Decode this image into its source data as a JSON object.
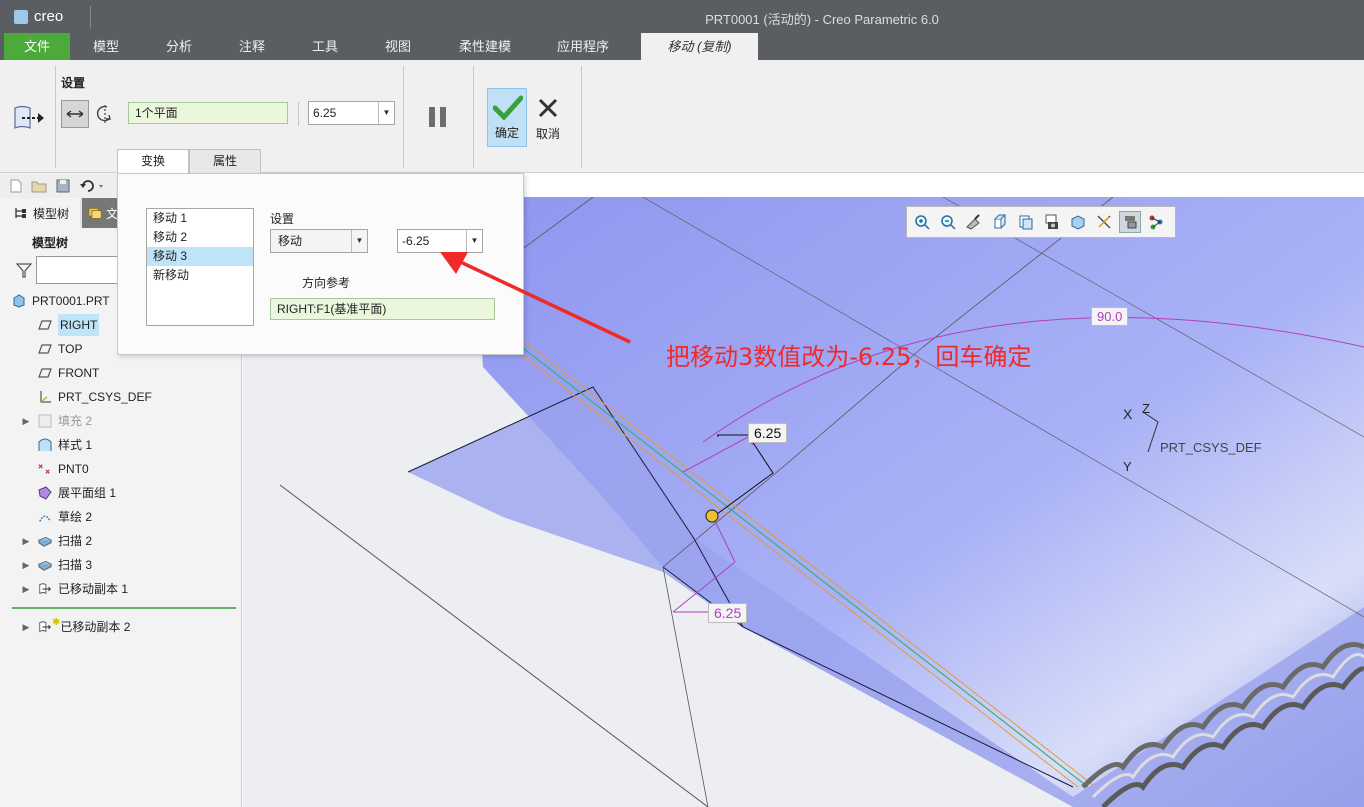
{
  "window": {
    "app_logo": "creo",
    "title": "PRT0001 (活动的) - Creo Parametric 6.0"
  },
  "menu": {
    "tabs": [
      "文件",
      "模型",
      "分析",
      "注释",
      "工具",
      "视图",
      "柔性建模",
      "应用程序",
      "移动 (复制)"
    ]
  },
  "ribbon": {
    "group_label": "设置",
    "reference_field": "1个平面",
    "distance_value": "6.25",
    "ok_label": "确定",
    "cancel_label": "取消",
    "subtabs": [
      "变换",
      "属性"
    ]
  },
  "panel": {
    "moves": [
      "移动 1",
      "移动 2",
      "移动 3",
      "新移动"
    ],
    "selected_move": "移动 3",
    "settings_label": "设置",
    "type_value": "移动",
    "value_field": "-6.25",
    "direction_label": "方向参考",
    "direction_ref": "RIGHT:F1(基准平面)"
  },
  "navigator": {
    "tab_model_tree": "模型树",
    "tab_folder_partial": "文",
    "tree_header": "模型树",
    "items": [
      {
        "label": "PRT0001.PRT",
        "icon": "part-icon",
        "expand": false,
        "indent": 0
      },
      {
        "label": "RIGHT",
        "icon": "datum-plane-icon",
        "expand": false,
        "indent": 1,
        "selected": true
      },
      {
        "label": "TOP",
        "icon": "datum-plane-icon",
        "expand": false,
        "indent": 1
      },
      {
        "label": "FRONT",
        "icon": "datum-plane-icon",
        "expand": false,
        "indent": 1
      },
      {
        "label": "PRT_CSYS_DEF",
        "icon": "csys-icon",
        "expand": false,
        "indent": 1
      },
      {
        "label": "填充 2",
        "icon": "fill-icon",
        "expand": true,
        "indent": 1,
        "dim": true
      },
      {
        "label": "样式 1",
        "icon": "style-icon",
        "expand": false,
        "indent": 1
      },
      {
        "label": "PNT0",
        "icon": "point-icon",
        "expand": false,
        "indent": 1
      },
      {
        "label": "展平面组 1",
        "icon": "flatten-icon",
        "expand": false,
        "indent": 1
      },
      {
        "label": "草绘 2",
        "icon": "sketch-icon",
        "expand": false,
        "indent": 1
      },
      {
        "label": "扫描 2",
        "icon": "sweep-icon",
        "expand": true,
        "indent": 1
      },
      {
        "label": "扫描 3",
        "icon": "sweep-icon",
        "expand": true,
        "indent": 1
      },
      {
        "label": "已移动副本 1",
        "icon": "moved-copy-icon",
        "expand": true,
        "indent": 1
      },
      {
        "label": "已移动副本 2",
        "icon": "moved-copy-icon",
        "expand": true,
        "indent": 1,
        "new": true
      }
    ]
  },
  "viewport": {
    "angle_dim": "90.0",
    "dim_top": "6.25",
    "dim_bottom": "6.25",
    "csys_label": "PRT_CSYS_DEF",
    "axis_x": "X",
    "axis_y": "Y",
    "axis_z": "Z"
  },
  "annotation": {
    "text": "把移动3数值改为-6.25，回车确定",
    "color": "#ee2a2a"
  },
  "colors": {
    "file_tab": "#4caa3a",
    "titlebar": "#5a5d61",
    "selection": "#bfe3f7",
    "dim_magenta": "#b040c0"
  }
}
